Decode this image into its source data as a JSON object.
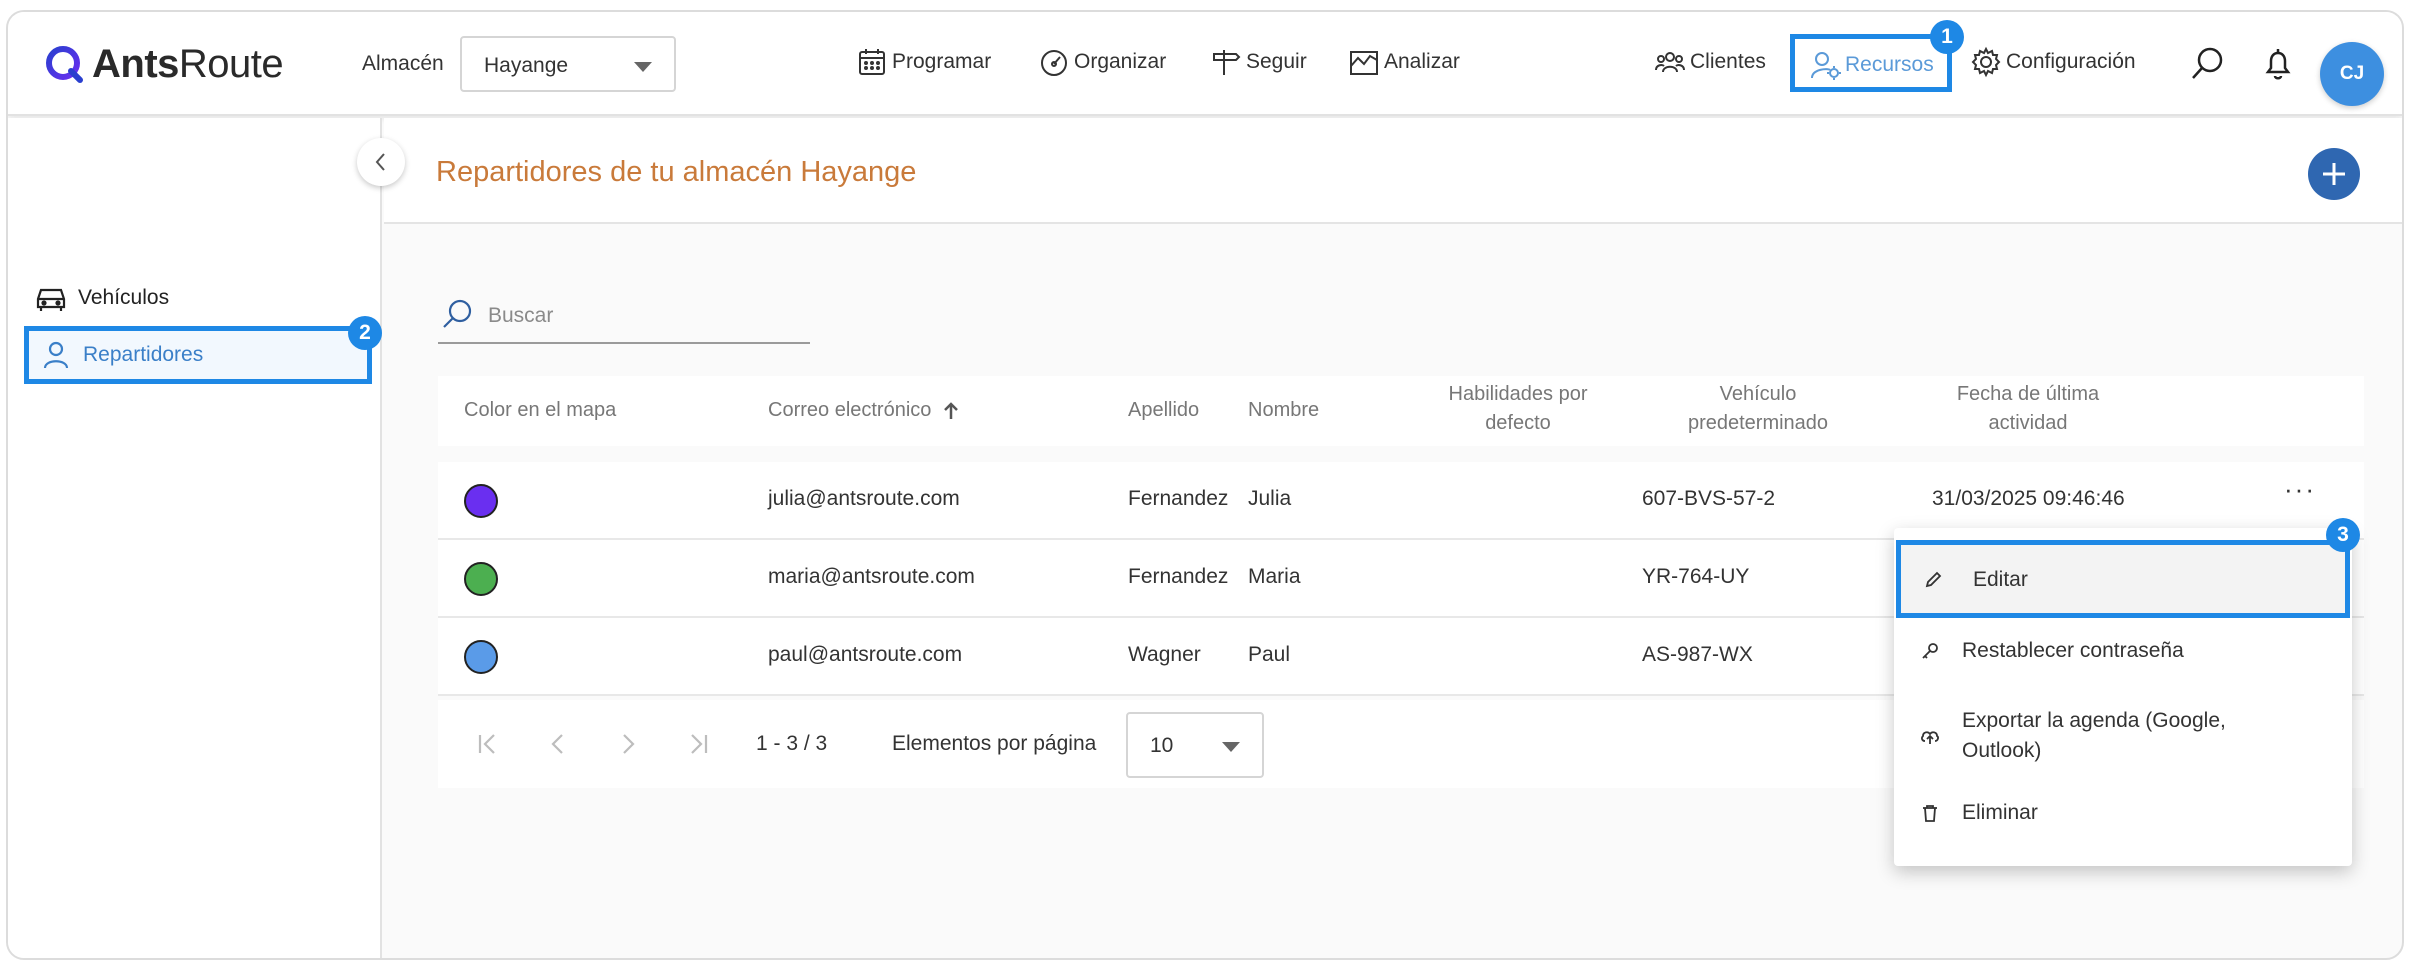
{
  "app": {
    "logo": {
      "text_bold": "Ants",
      "text_regular": "Route",
      "icon": "antsroute-logo-icon"
    }
  },
  "header": {
    "warehouse_label": "Almacén",
    "warehouse_value": "Hayange",
    "nav": [
      {
        "label": "Programar",
        "icon": "calendar-icon"
      },
      {
        "label": "Organizar",
        "icon": "gauge-icon"
      },
      {
        "label": "Seguir",
        "icon": "signpost-icon"
      },
      {
        "label": "Analizar",
        "icon": "chart-icon"
      },
      {
        "label": "Clientes",
        "icon": "users-icon"
      },
      {
        "label": "Recursos",
        "icon": "user-gear-icon",
        "active": true
      },
      {
        "label": "Configuración",
        "icon": "gear-icon"
      }
    ],
    "avatar_initials": "CJ"
  },
  "annotations": {
    "badge1": "1",
    "badge2": "2",
    "badge3": "3"
  },
  "sidebar": {
    "items": [
      {
        "label": "Vehículos",
        "icon": "car-icon"
      },
      {
        "label": "Repartidores",
        "icon": "person-icon",
        "active": true
      }
    ]
  },
  "page": {
    "title": "Repartidores de tu almacén Hayange",
    "search_placeholder": "Buscar"
  },
  "table": {
    "headers": {
      "color": "Color en el mapa",
      "email": "Correo electrónico",
      "lastname": "Apellido",
      "firstname": "Nombre",
      "skills_1": "Habilidades por",
      "skills_2": "defecto",
      "vehicle_1": "Vehículo",
      "vehicle_2": "predeterminado",
      "activity_1": "Fecha de última",
      "activity_2": "actividad"
    },
    "rows": [
      {
        "color": "#6a2ff0",
        "email": "julia@antsroute.com",
        "lastname": "Fernandez",
        "firstname": "Julia",
        "vehicle": "607-BVS-57-2",
        "last_activity": "31/03/2025 09:46:46",
        "more": "···"
      },
      {
        "color": "#4caf50",
        "email": "maria@antsroute.com",
        "lastname": "Fernandez",
        "firstname": "Maria",
        "vehicle": "YR-764-UY",
        "last_activity": "",
        "more": ""
      },
      {
        "color": "#5a9be8",
        "email": "paul@antsroute.com",
        "lastname": "Wagner",
        "firstname": "Paul",
        "vehicle": "AS-987-WX",
        "last_activity": "",
        "more": ""
      }
    ]
  },
  "pagination": {
    "range": "1 - 3 / 3",
    "per_page_label": "Elementos por página",
    "per_page_value": "10"
  },
  "context_menu": {
    "items": [
      {
        "label": "Editar",
        "icon": "pencil-icon"
      },
      {
        "label": "Restablecer contraseña",
        "icon": "key-icon"
      },
      {
        "label_line1": "Exportar la agenda (Google,",
        "label_line2": "Outlook)",
        "icon": "cloud-upload-icon"
      },
      {
        "label": "Eliminar",
        "icon": "trash-icon"
      }
    ]
  },
  "colors": {
    "accent": "#1e88e5",
    "title": "#c97a3a",
    "add_button": "#2f67b1",
    "avatar": "#3d8fe0"
  }
}
